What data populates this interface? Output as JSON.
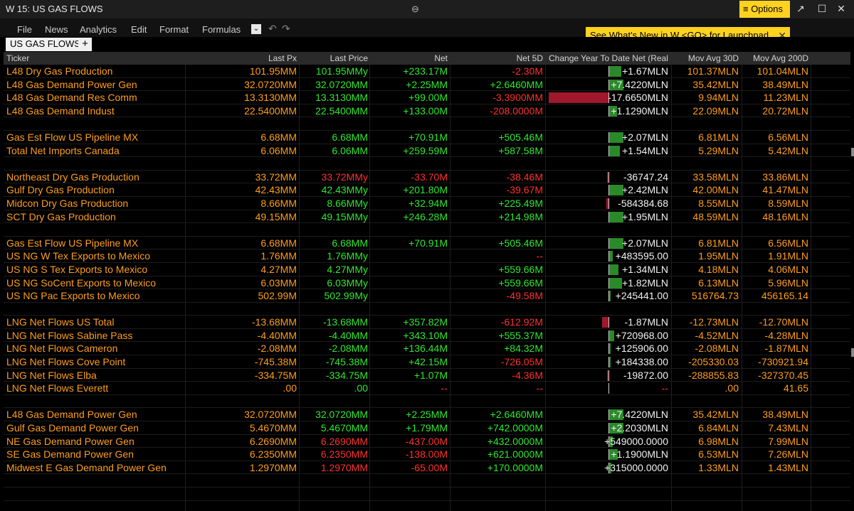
{
  "window": {
    "title": "W 15: US GAS FLOWS",
    "options_label": "≡ Options",
    "tooltip": "See What's New in W <GO> for Launchpad"
  },
  "menu": [
    "File",
    "News",
    "Analytics",
    "Edit",
    "Format",
    "Formulas"
  ],
  "tab": {
    "label": "US GAS FLOWS",
    "add": "+"
  },
  "columns": [
    "Ticker",
    "Last Px",
    "Last Price",
    "Net",
    "Net 5D",
    "Change Year To Date Net (Real",
    "Mov Avg 30D",
    "Mov Avg 200D"
  ],
  "rows": [
    {
      "t": "L48 Dry Gas Production",
      "px": "101.95MM",
      "lp": "101.95MMy",
      "lpc": "green",
      "net": "+233.17M",
      "netc": "green",
      "n5": "-2.30M",
      "n5c": "red",
      "ytd": "+1.67MLN",
      "ytdv": 1.67,
      "ma30": "101.37MLN",
      "ma200": "101.04MLN"
    },
    {
      "t": "L48 Gas Demand Power Gen",
      "px": "32.0720MM",
      "lp": "32.0720MM",
      "lpc": "green",
      "net": "+2.25MM",
      "netc": "green",
      "n5": "+2.6460MM",
      "n5c": "green",
      "ytd": "+7.4220MLN",
      "ytdv": 7.422,
      "ma30": "35.42MLN",
      "ma200": "38.49MLN"
    },
    {
      "t": "L48 Gas Demand Res Comm",
      "px": "13.3130MM",
      "lp": "13.3130MM",
      "lpc": "green",
      "net": "+99.00M",
      "netc": "green",
      "n5": "-3.3900MM",
      "n5c": "red",
      "ytd": "-17.6650MLN",
      "ytdv": -17.665,
      "ma30": "9.94MLN",
      "ma200": "11.23MLN"
    },
    {
      "t": "L48 Gas Demand Indust",
      "px": "22.5400MM",
      "lp": "22.5400MM",
      "lpc": "green",
      "net": "+133.00M",
      "netc": "green",
      "n5": "-208.0000M",
      "n5c": "red",
      "ytd": "+1.1290MLN",
      "ytdv": 1.129,
      "ma30": "22.09MLN",
      "ma200": "20.72MLN"
    },
    {
      "blank": true
    },
    {
      "t": "Gas Est Flow US Pipeline MX",
      "px": "6.68MM",
      "lp": "6.68MM",
      "lpc": "green",
      "net": "+70.91M",
      "netc": "green",
      "n5": "+505.46M",
      "n5c": "green",
      "ytd": "+2.07MLN",
      "ytdv": 2.07,
      "ma30": "6.81MLN",
      "ma200": "6.56MLN"
    },
    {
      "t": "Total Net Imports Canada",
      "px": "6.06MM",
      "lp": "6.06MM",
      "lpc": "green",
      "net": "+259.59M",
      "netc": "green",
      "n5": "+587.58M",
      "n5c": "green",
      "ytd": "+1.54MLN",
      "ytdv": 1.54,
      "ma30": "5.29MLN",
      "ma200": "5.42MLN"
    },
    {
      "blank": true
    },
    {
      "t": "Northeast Dry Gas Production",
      "px": "33.72MM",
      "lp": "33.72MMy",
      "lpc": "red",
      "net": "-33.70M",
      "netc": "red",
      "n5": "-38.46M",
      "n5c": "red",
      "ytd": "-36747.24",
      "ytdv": -0.036,
      "ma30": "33.58MLN",
      "ma200": "33.86MLN"
    },
    {
      "t": "Gulf Dry Gas Production",
      "px": "42.43MM",
      "lp": "42.43MMy",
      "lpc": "green",
      "net": "+201.80M",
      "netc": "green",
      "n5": "-39.67M",
      "n5c": "red",
      "ytd": "+2.42MLN",
      "ytdv": 2.42,
      "ma30": "42.00MLN",
      "ma200": "41.47MLN"
    },
    {
      "t": "Midcon Dry Gas Production",
      "px": "8.66MM",
      "lp": "8.66MMy",
      "lpc": "green",
      "net": "+32.94M",
      "netc": "green",
      "n5": "+225.49M",
      "n5c": "green",
      "ytd": "-584384.68",
      "ytdv": -0.584,
      "ma30": "8.55MLN",
      "ma200": "8.59MLN"
    },
    {
      "t": "SCT Dry Gas Production",
      "px": "49.15MM",
      "lp": "49.15MMy",
      "lpc": "green",
      "net": "+246.28M",
      "netc": "green",
      "n5": "+214.98M",
      "n5c": "green",
      "ytd": "+1.95MLN",
      "ytdv": 1.95,
      "ma30": "48.59MLN",
      "ma200": "48.16MLN"
    },
    {
      "blank": true
    },
    {
      "t": "Gas Est Flow US Pipeline MX",
      "px": "6.68MM",
      "lp": "6.68MM",
      "lpc": "green",
      "net": "+70.91M",
      "netc": "green",
      "n5": "+505.46M",
      "n5c": "green",
      "ytd": "+2.07MLN",
      "ytdv": 2.07,
      "ma30": "6.81MLN",
      "ma200": "6.56MLN"
    },
    {
      "t": "US NG W Tex Exports to Mexico",
      "px": "1.76MM",
      "lp": "1.76MMy",
      "lpc": "green",
      "net": "",
      "netc": "green",
      "n5": "--",
      "n5c": "red",
      "ytd": "+483595.00",
      "ytdv": 0.48,
      "ma30": "1.95MLN",
      "ma200": "1.91MLN"
    },
    {
      "t": "US NG S Tex Exports to Mexico",
      "px": "4.27MM",
      "lp": "4.27MMy",
      "lpc": "green",
      "net": "",
      "netc": "green",
      "n5": "+559.66M",
      "n5c": "green",
      "ytd": "+1.34MLN",
      "ytdv": 1.34,
      "ma30": "4.18MLN",
      "ma200": "4.06MLN"
    },
    {
      "t": "US NG SoCent Exports to Mexico",
      "px": "6.03MM",
      "lp": "6.03MMy",
      "lpc": "green",
      "net": "",
      "netc": "green",
      "n5": "+559.66M",
      "n5c": "green",
      "ytd": "+1.82MLN",
      "ytdv": 1.82,
      "ma30": "6.13MLN",
      "ma200": "5.96MLN"
    },
    {
      "t": "US NG Pac Exports to Mexico",
      "px": "502.99M",
      "lp": "502.99My",
      "lpc": "green",
      "net": "",
      "netc": "green",
      "n5": "-49.58M",
      "n5c": "red",
      "ytd": "+245441.00",
      "ytdv": 0.245,
      "ma30": "516764.73",
      "ma200": "456165.14"
    },
    {
      "blank": true
    },
    {
      "t": "LNG Net Flows US Total",
      "px": "-13.68MM",
      "lp": "-13.68MM",
      "lpc": "green",
      "net": "+357.82M",
      "netc": "green",
      "n5": "-612.92M",
      "n5c": "red",
      "ytd": "-1.87MLN",
      "ytdv": -1.87,
      "ma30": "-12.73MLN",
      "ma200": "-12.70MLN"
    },
    {
      "t": "LNG Net Flows Sabine Pass",
      "px": "-4.40MM",
      "lp": "-4.40MM",
      "lpc": "green",
      "net": "+343.10M",
      "netc": "green",
      "n5": "+555.37M",
      "n5c": "green",
      "ytd": "+720968.00",
      "ytdv": 0.72,
      "ma30": "-4.52MLN",
      "ma200": "-4.28MLN"
    },
    {
      "t": "LNG Net Flows Cameron",
      "px": "-2.08MM",
      "lp": "-2.08MM",
      "lpc": "green",
      "net": "+136.44M",
      "netc": "green",
      "n5": "+84.32M",
      "n5c": "green",
      "ytd": "+125906.00",
      "ytdv": 0.126,
      "ma30": "-2.08MLN",
      "ma200": "-1.87MLN"
    },
    {
      "t": "LNG Net Flows Cove Point",
      "px": "-745.38M",
      "lp": "-745.38M",
      "lpc": "green",
      "net": "+42.15M",
      "netc": "green",
      "n5": "-726.05M",
      "n5c": "red",
      "ytd": "+184338.00",
      "ytdv": 0.184,
      "ma30": "-205330.03",
      "ma200": "-730921.94"
    },
    {
      "t": "LNG Net Flows Elba",
      "px": "-334.75M",
      "lp": "-334.75M",
      "lpc": "green",
      "net": "+1.07M",
      "netc": "green",
      "n5": "-4.36M",
      "n5c": "red",
      "ytd": "-19872.00",
      "ytdv": -0.02,
      "ma30": "-288855.83",
      "ma200": "-327370.45"
    },
    {
      "t": "LNG Net Flows Everett",
      "px": ".00",
      "lp": ".00",
      "lpc": "green",
      "net": "--",
      "netc": "red",
      "n5": "--",
      "n5c": "red",
      "ytd": "--",
      "ytdv": 0,
      "ytdc": "red",
      "ma30": ".00",
      "ma200": "41.65"
    },
    {
      "blank": true
    },
    {
      "t": "L48 Gas Demand Power Gen",
      "px": "32.0720MM",
      "lp": "32.0720MM",
      "lpc": "green",
      "net": "+2.25MM",
      "netc": "green",
      "n5": "+2.6460MM",
      "n5c": "green",
      "ytd": "+7.4220MLN",
      "ytdv": 7.422,
      "ma30": "35.42MLN",
      "ma200": "38.49MLN"
    },
    {
      "t": "Gulf Gas Demand Power Gen",
      "px": "5.4670MM",
      "lp": "5.4670MM",
      "lpc": "green",
      "net": "+1.79MM",
      "netc": "green",
      "n5": "+742.0000M",
      "n5c": "green",
      "ytd": "+2.2030MLN",
      "ytdv": 2.203,
      "ma30": "6.84MLN",
      "ma200": "7.43MLN"
    },
    {
      "t": "NE Gas Demand Power Gen",
      "px": "6.2690MM",
      "lp": "6.2690MM",
      "lpc": "red",
      "net": "-437.00M",
      "netc": "red",
      "n5": "+432.0000M",
      "n5c": "green",
      "ytd": "+549000.0000",
      "ytdv": 0.549,
      "ma30": "6.98MLN",
      "ma200": "7.99MLN"
    },
    {
      "t": "SE Gas Demand Power Gen",
      "px": "6.2350MM",
      "lp": "6.2350MM",
      "lpc": "red",
      "net": "-138.00M",
      "netc": "red",
      "n5": "+621.0000M",
      "n5c": "green",
      "ytd": "+1.1900MLN",
      "ytdv": 1.19,
      "ma30": "6.53MLN",
      "ma200": "7.26MLN"
    },
    {
      "t": "Midwest E Gas Demand Power Gen",
      "px": "1.2970MM",
      "lp": "1.2970MM",
      "lpc": "red",
      "net": "-65.00M",
      "netc": "red",
      "n5": "+170.0000M",
      "n5c": "green",
      "ytd": "+315000.0000",
      "ytdv": 0.315,
      "ma30": "1.33MLN",
      "ma200": "1.43MLN"
    },
    {
      "blank": true
    },
    {
      "blank": true
    }
  ]
}
